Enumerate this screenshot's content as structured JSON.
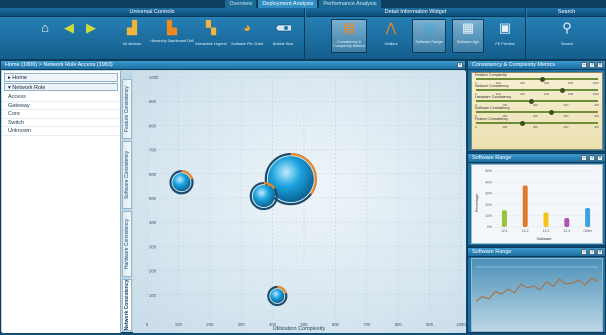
{
  "top_tabs": [
    "Overview",
    "Deployment Analysis",
    "Performance Analysis"
  ],
  "active_tab_index": 1,
  "ribbon": {
    "universal_title": "Universal Controls",
    "detail_title": "Detail Information Widget",
    "search_title": "Search",
    "buttons": {
      "all_devices": "All devices",
      "hierarchy": "Hierarchy Dashboard Drill",
      "interactive_legend": "Interactive Legend",
      "pie_chart": "Software Pie Chart",
      "bubble_size": "Bubble Size",
      "consistency": "Consistency & Complexity Metrics",
      "outliers": "Outliers",
      "software_range": "Software Range",
      "software_age": "Software Age",
      "fe_preview": "FE Preview",
      "search": "Search"
    }
  },
  "main": {
    "breadcrumb": "Home (1806) > Network Role Access (1983)",
    "sidebar": {
      "home": "Home",
      "network_role": "Network Role",
      "items": [
        "Access",
        "Gateway",
        "Core",
        "Switch",
        "Unknown"
      ]
    },
    "vertical_tabs": [
      "Feature Consistency",
      "Software Consistency",
      "Hardware Consistency",
      "Network Consistency"
    ],
    "active_vertical_tab": 3
  },
  "chart_data": {
    "type": "scatter",
    "subtype": "bubble",
    "xlabel": "Utilization Complexity",
    "ylabel": "",
    "xlim": [
      0,
      1000
    ],
    "ylim": [
      0,
      1000
    ],
    "x_ticks": [
      0,
      100,
      200,
      300,
      400,
      500,
      600,
      700,
      800,
      900,
      1000
    ],
    "y_ticks": [
      100,
      200,
      300,
      400,
      500,
      600,
      700,
      800,
      900,
      1000
    ],
    "points": [
      {
        "x": 110,
        "y": 565,
        "size": 9,
        "ring": 0.2
      },
      {
        "x": 458,
        "y": 578,
        "size": 23,
        "ring": 0.35
      },
      {
        "x": 372,
        "y": 508,
        "size": 11,
        "ring": 0.15
      },
      {
        "x": 415,
        "y": 95,
        "size": 7,
        "ring": 0.2
      }
    ],
    "grid": true
  },
  "panels": {
    "metrics": {
      "title": "Consistency & Complexity Metrics",
      "rows": [
        {
          "label": "Relative Complexity",
          "ticks": [
            "0",
            "200",
            "400",
            "600",
            "800",
            "1000"
          ],
          "value": 0.55
        },
        {
          "label": "Network Consistency",
          "ticks": [
            "0",
            "200",
            "400",
            "600",
            "800",
            "1000"
          ],
          "value": 0.72
        },
        {
          "label": "Hardware Consistency",
          "ticks": [
            "0",
            "100",
            "200",
            "300",
            "400"
          ],
          "value": 0.45
        },
        {
          "label": "Software Consistency",
          "ticks": [
            "0",
            "100",
            "200",
            "300",
            "400"
          ],
          "value": 0.62
        },
        {
          "label": "Feature Consistency",
          "ticks": [
            "0",
            "100",
            "200",
            "300",
            "400"
          ],
          "value": 0.38
        }
      ]
    },
    "software_range": {
      "title": "Software Range",
      "xlabel": "Software",
      "ylabel": "Percentage",
      "chart_data": {
        "type": "bar",
        "categories": [
          "12.1",
          "12.2",
          "12.3",
          "12.4",
          "Other"
        ],
        "values": [
          15,
          37,
          13,
          8,
          17
        ],
        "colors": [
          "#9bc23c",
          "#e07a2a",
          "#f0c419",
          "#b04fb8",
          "#3aa3d8"
        ],
        "y_ticks": [
          "0%",
          "10%",
          "20%",
          "30%",
          "40%",
          "50%"
        ],
        "ylim": [
          0,
          50
        ]
      }
    },
    "software_trend": {
      "title": "Software Range",
      "chart_data": {
        "type": "line",
        "values": [
          0.35,
          0.45,
          0.4,
          0.55,
          0.5,
          0.6,
          0.52,
          0.7,
          0.62,
          0.66,
          0.58,
          0.75,
          0.65,
          0.8,
          0.7,
          0.72,
          0.78,
          0.68,
          0.82,
          0.75
        ],
        "color": "#b06a3a"
      }
    }
  },
  "colors": {
    "accent": "#1e73a5",
    "bubble": "#1ba3de",
    "ring_orange": "#ee8a2c"
  }
}
